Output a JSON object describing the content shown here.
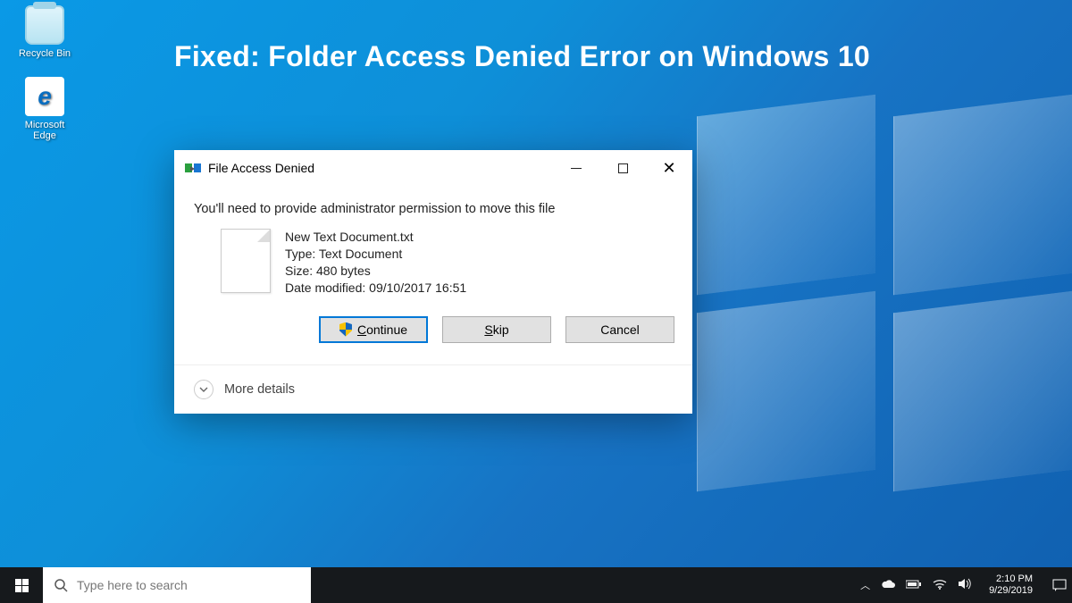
{
  "headline": "Fixed: Folder Access Denied Error on Windows 10",
  "desktop": {
    "recycle_label": "Recycle Bin",
    "edge_label": "Microsoft Edge"
  },
  "dialog": {
    "title": "File Access Denied",
    "message": "You'll need to provide administrator permission to move this file",
    "file": {
      "name": "New Text Document.txt",
      "type_line": "Type: Text Document",
      "size_line": "Size: 480 bytes",
      "date_line": "Date modified: 09/10/2017 16:51"
    },
    "buttons": {
      "continue": "Continue",
      "skip": "Skip",
      "cancel": "Cancel"
    },
    "more_details": "More details"
  },
  "taskbar": {
    "search_placeholder": "Type here to search",
    "time": "2:10 PM",
    "date": "9/29/2019"
  }
}
